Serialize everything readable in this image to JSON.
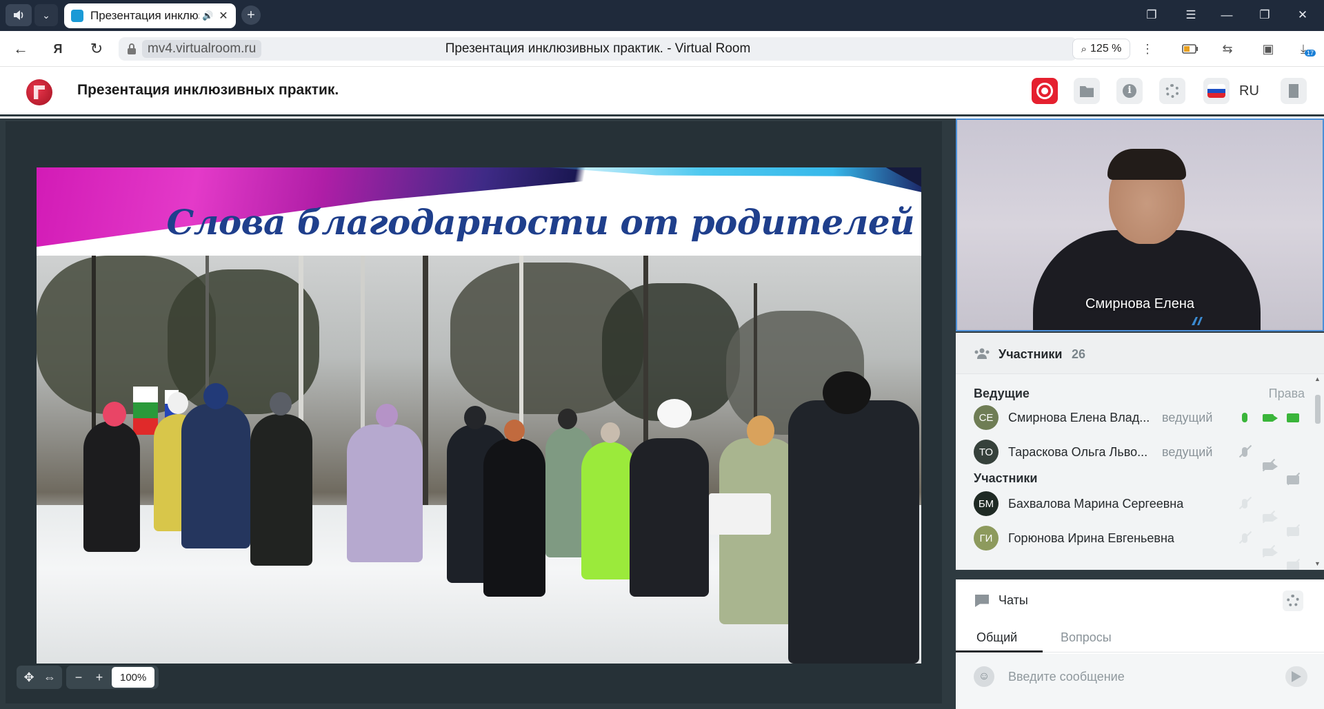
{
  "browser": {
    "tab_title": "Презентация инклюзивных практик. - Virtual Room",
    "tab_title_short": "Презентация инклюз",
    "url_domain": "mv4.virtualroom.ru",
    "page_title": "Презентация инклюзивных практик. - Virtual Room",
    "zoom": "125 %",
    "downloads_badge": "17"
  },
  "app": {
    "title": "Презентация инклюзивных практик.",
    "language": "RU"
  },
  "slide": {
    "title": "Слова благодарности от родителей",
    "zoom": "100%"
  },
  "video": {
    "speaker_name": "Смирнова Елена"
  },
  "participants": {
    "header": "Участники",
    "count": "26",
    "hosts_label": "Ведущие",
    "rights_label": "Права",
    "attendees_label": "Участники",
    "hosts": [
      {
        "initials": "СЕ",
        "name": "Смирнова Елена Влад...",
        "role": "ведущий",
        "mic": "on",
        "camera": "on",
        "screen": "on",
        "avatar_color": "#6f7d55"
      },
      {
        "initials": "ТО",
        "name": "Тараскова Ольга Льво...",
        "role": "ведущий",
        "mic": "off",
        "camera": "off",
        "screen": "off",
        "avatar_color": "#36413b"
      }
    ],
    "attendees": [
      {
        "initials": "БМ",
        "name": "Бахвалова Марина Сергеевна",
        "avatar_color": "#1f2a24"
      },
      {
        "initials": "ГИ",
        "name": "Горюнова Ирина Евгеньевна",
        "avatar_color": "#8d9a5d"
      }
    ]
  },
  "chat": {
    "title": "Чаты",
    "tab_general": "Общий",
    "tab_questions": "Вопросы",
    "placeholder": "Введите сообщение"
  },
  "colors": {
    "accent_record": "#e5202f",
    "active_icon": "#3ab53a",
    "dark_panel": "#2e3a40",
    "slide_title": "#1f3f8c"
  }
}
